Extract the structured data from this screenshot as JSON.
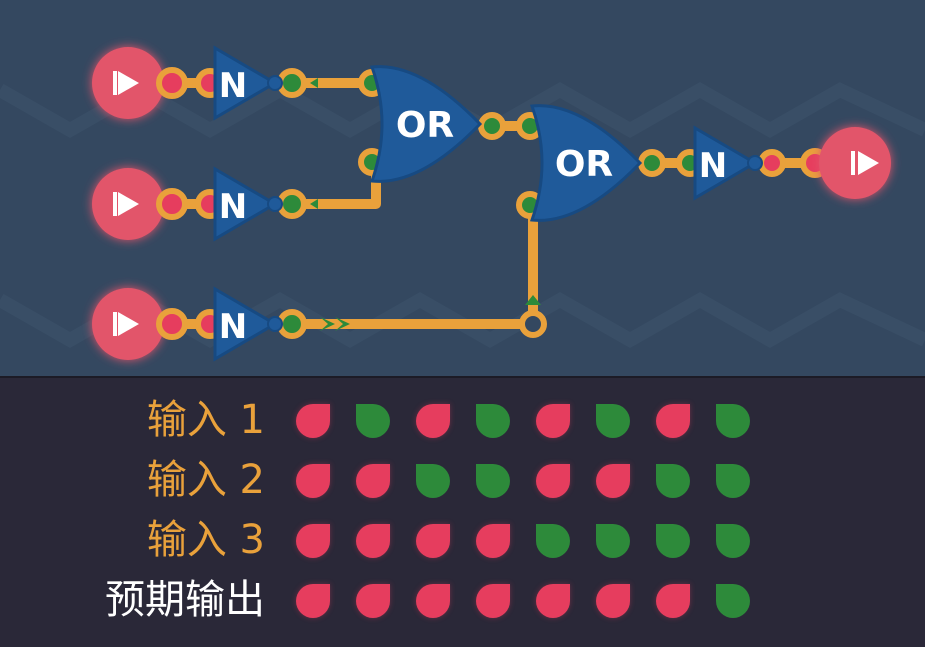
{
  "circuit": {
    "inputs": [
      {
        "name": "input-1",
        "symbol": "▶"
      },
      {
        "name": "input-2",
        "symbol": "▶"
      },
      {
        "name": "input-3",
        "symbol": "▶"
      }
    ],
    "not_gates": [
      {
        "label": "N"
      },
      {
        "label": "N"
      },
      {
        "label": "N"
      },
      {
        "label": "N"
      }
    ],
    "or_gates": [
      {
        "label": "OR"
      },
      {
        "label": "OR"
      }
    ],
    "output": {
      "symbol": "▶"
    },
    "colors": {
      "board": "#344860",
      "wire": "#e9a13b",
      "gate": "#1f5a9a",
      "io_node": "#e2556b",
      "signal_on": "#2d8a3a",
      "signal_off": "#e63d5e"
    }
  },
  "truth_table": {
    "rows": [
      {
        "label": "输入 1",
        "values": [
          0,
          1,
          0,
          1,
          0,
          1,
          0,
          1
        ]
      },
      {
        "label": "输入 2",
        "values": [
          0,
          0,
          1,
          1,
          0,
          0,
          1,
          1
        ]
      },
      {
        "label": "输入 3",
        "values": [
          0,
          0,
          0,
          0,
          1,
          1,
          1,
          1
        ]
      },
      {
        "label": "预期输出",
        "values": [
          0,
          0,
          0,
          0,
          0,
          0,
          0,
          1
        ]
      }
    ]
  }
}
